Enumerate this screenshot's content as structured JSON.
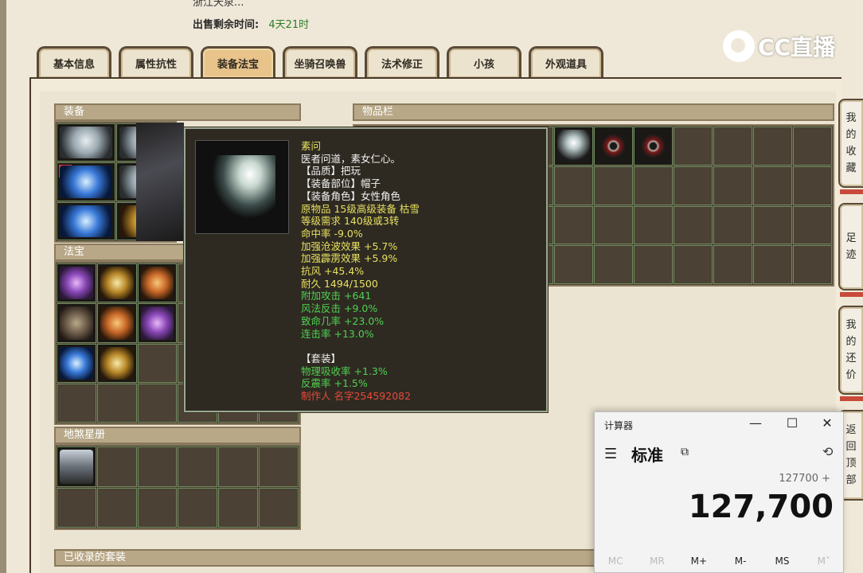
{
  "header": {
    "cut_text": "浙江天泉...",
    "sale_label": "出售剩余时间:",
    "sale_value": "4天21时"
  },
  "tabs": [
    {
      "label": "基本信息",
      "active": false
    },
    {
      "label": "属性抗性",
      "active": false
    },
    {
      "label": "装备法宝",
      "active": true
    },
    {
      "label": "坐骑召唤兽",
      "active": false
    },
    {
      "label": "法术修正",
      "active": false
    },
    {
      "label": "小孩",
      "active": false
    },
    {
      "label": "外观道具",
      "active": false
    }
  ],
  "panels": {
    "equipment": "装备",
    "fabao": "法宝",
    "dishaxingce": "地煞星册",
    "inventory": "物品栏",
    "collected_sets": "已收录的套装"
  },
  "equipment_limit_badge": "限",
  "tooltip": {
    "name": "素问",
    "lines": [
      {
        "text": "医者问道，素女仁心。",
        "color": "white"
      },
      {
        "text": "【品质】把玩",
        "color": "white"
      },
      {
        "text": "【装备部位】帽子",
        "color": "white"
      },
      {
        "text": "【装备角色】女性角色",
        "color": "white"
      },
      {
        "text": "原物品 15级高级装备 枯雪",
        "color": "yellow"
      },
      {
        "text": "等级需求 140级或3转",
        "color": "yellow"
      },
      {
        "text": "命中率 -9.0%",
        "color": "yellow"
      },
      {
        "text": "加强沧波效果 +5.7%",
        "color": "yellow"
      },
      {
        "text": "加强霹雳效果 +5.9%",
        "color": "yellow"
      },
      {
        "text": "抗风 +45.4%",
        "color": "yellow"
      },
      {
        "text": "耐久 1494/1500",
        "color": "yellow"
      },
      {
        "text": "附加攻击 +641",
        "color": "green"
      },
      {
        "text": "风法反击 +9.0%",
        "color": "green"
      },
      {
        "text": "致命几率 +23.0%",
        "color": "green"
      },
      {
        "text": "连击率 +13.0%",
        "color": "green"
      },
      {
        "text": "",
        "color": "blank"
      },
      {
        "text": "【套装】",
        "color": "white"
      },
      {
        "text": "物理吸收率 +1.3%",
        "color": "green"
      },
      {
        "text": "反震率 +1.5%",
        "color": "green"
      },
      {
        "text": "制作人 名字254592082",
        "color": "red"
      }
    ]
  },
  "side_buttons": [
    {
      "label": "我的收藏"
    },
    {
      "label": "足迹"
    },
    {
      "label": "我的还价"
    },
    {
      "label": "返回顶部"
    }
  ],
  "logo": {
    "text": "CC直播"
  },
  "calculator": {
    "title": "计算器",
    "mode": "标准",
    "expression": "127700 +",
    "display": "127,700",
    "memory_buttons": [
      {
        "label": "MC",
        "enabled": false
      },
      {
        "label": "MR",
        "enabled": false
      },
      {
        "label": "M+",
        "enabled": true
      },
      {
        "label": "M-",
        "enabled": true
      },
      {
        "label": "MS",
        "enabled": true
      },
      {
        "label": "M˅",
        "enabled": false
      }
    ],
    "controls": {
      "minimize": "—",
      "maximize": "☐",
      "close": "✕"
    }
  }
}
